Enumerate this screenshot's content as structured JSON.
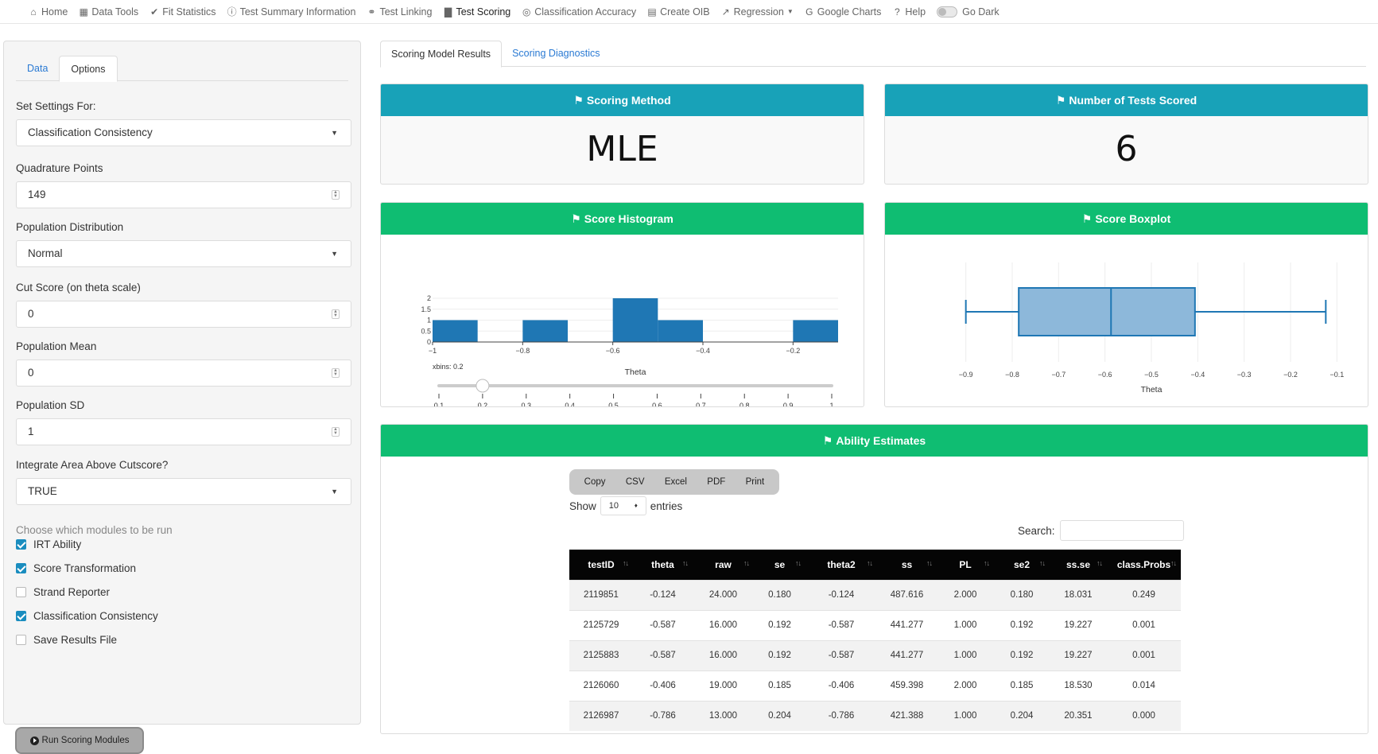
{
  "nav": {
    "items": [
      {
        "label": "Home",
        "icon": "home-icon",
        "glyph": "⌂"
      },
      {
        "label": "Data Tools",
        "icon": "calendar-icon",
        "glyph": "▦"
      },
      {
        "label": "Fit Statistics",
        "icon": "check-icon",
        "glyph": "✔"
      },
      {
        "label": "Test Summary Information",
        "icon": "info-icon",
        "glyph": "ⓘ"
      },
      {
        "label": "Test Linking",
        "icon": "link-icon",
        "glyph": "⚭"
      },
      {
        "label": "Test Scoring",
        "icon": "chart-bar-icon",
        "glyph": "▇"
      },
      {
        "label": "Classification Accuracy",
        "icon": "bullseye-icon",
        "glyph": "◎"
      },
      {
        "label": "Create OIB",
        "icon": "book-icon",
        "glyph": "▤"
      },
      {
        "label": "Regression",
        "icon": "line-chart-icon",
        "glyph": "↗"
      },
      {
        "label": "Google Charts",
        "icon": "google-icon",
        "glyph": "G"
      },
      {
        "label": "Help",
        "icon": "question-icon",
        "glyph": "?"
      }
    ],
    "dark_label": "Go Dark"
  },
  "sidebar": {
    "tabs": [
      "Data",
      "Options"
    ],
    "settings_for_label": "Set Settings For:",
    "settings_for_value": "Classification Consistency",
    "quad_label": "Quadrature Points",
    "quad_value": "149",
    "popdist_label": "Population Distribution",
    "popdist_value": "Normal",
    "cut_label": "Cut Score (on theta scale)",
    "cut_value": "0",
    "mean_label": "Population Mean",
    "mean_value": "0",
    "sd_label": "Population SD",
    "sd_value": "1",
    "integrate_label": "Integrate Area Above Cutscore?",
    "integrate_value": "TRUE",
    "modules_help": "Choose which modules to be run",
    "modules": [
      {
        "label": "IRT Ability",
        "checked": true
      },
      {
        "label": "Score Transformation",
        "checked": true
      },
      {
        "label": "Strand Reporter",
        "checked": false
      },
      {
        "label": "Classification Consistency",
        "checked": true
      },
      {
        "label": "Save Results File",
        "checked": false
      }
    ],
    "run_label": "Run Scoring Modules"
  },
  "main": {
    "tabs": [
      "Scoring Model Results",
      "Scoring Diagnostics"
    ],
    "scoring_method_title": "Scoring Method",
    "scoring_method_value": "MLE",
    "tests_scored_title": "Number of Tests Scored",
    "tests_scored_value": "6",
    "histogram_title": "Score Histogram",
    "boxplot_title": "Score Boxplot",
    "ability_title": "Ability Estimates"
  },
  "chart_data": [
    {
      "type": "bar",
      "title": "Score Histogram",
      "xlabel": "Theta",
      "ylabel": "",
      "bins": [
        {
          "start": -1.0,
          "end": -0.9,
          "count": 1
        },
        {
          "start": -0.8,
          "end": -0.7,
          "count": 1
        },
        {
          "start": -0.6,
          "end": -0.5,
          "count": 2
        },
        {
          "start": -0.5,
          "end": -0.4,
          "count": 1
        },
        {
          "start": -0.2,
          "end": -0.1,
          "count": 1
        }
      ],
      "xticks": [
        "−1",
        "−0.8",
        "−0.6",
        "−0.4",
        "−0.2"
      ],
      "yticks": [
        "0",
        "0.5",
        "1",
        "1.5",
        "2"
      ],
      "xlim": [
        -1.0,
        -0.1
      ],
      "ylim": [
        0,
        2
      ],
      "slider": {
        "label": "xbins: 0.2",
        "value": 0.2,
        "ticks": [
          "0.1",
          "0.2",
          "0.3",
          "0.4",
          "0.5",
          "0.6",
          "0.7",
          "0.8",
          "0.9",
          "1"
        ]
      }
    },
    {
      "type": "boxplot",
      "title": "Score Boxplot",
      "xlabel": "Theta",
      "min": -0.9,
      "q1": -0.786,
      "median": -0.587,
      "q3": -0.406,
      "max": -0.124,
      "xticks": [
        "−0.9",
        "−0.8",
        "−0.7",
        "−0.6",
        "−0.5",
        "−0.4",
        "−0.3",
        "−0.2",
        "−0.1"
      ],
      "xlim": [
        -0.92,
        -0.08
      ]
    }
  ],
  "table": {
    "buttons": [
      "Copy",
      "CSV",
      "Excel",
      "PDF",
      "Print"
    ],
    "show_label": "Show",
    "show_value": "10",
    "entries_label": "entries",
    "search_label": "Search:",
    "columns": [
      "testID",
      "theta",
      "raw",
      "se",
      "theta2",
      "ss",
      "PL",
      "se2",
      "ss.se",
      "class.Probs"
    ],
    "rows": [
      [
        "2119851",
        "-0.124",
        "24.000",
        "0.180",
        "-0.124",
        "487.616",
        "2.000",
        "0.180",
        "18.031",
        "0.249"
      ],
      [
        "2125729",
        "-0.587",
        "16.000",
        "0.192",
        "-0.587",
        "441.277",
        "1.000",
        "0.192",
        "19.227",
        "0.001"
      ],
      [
        "2125883",
        "-0.587",
        "16.000",
        "0.192",
        "-0.587",
        "441.277",
        "1.000",
        "0.192",
        "19.227",
        "0.001"
      ],
      [
        "2126060",
        "-0.406",
        "19.000",
        "0.185",
        "-0.406",
        "459.398",
        "2.000",
        "0.185",
        "18.530",
        "0.014"
      ],
      [
        "2126987",
        "-0.786",
        "13.000",
        "0.204",
        "-0.786",
        "421.388",
        "1.000",
        "0.204",
        "20.351",
        "0.000"
      ]
    ]
  }
}
